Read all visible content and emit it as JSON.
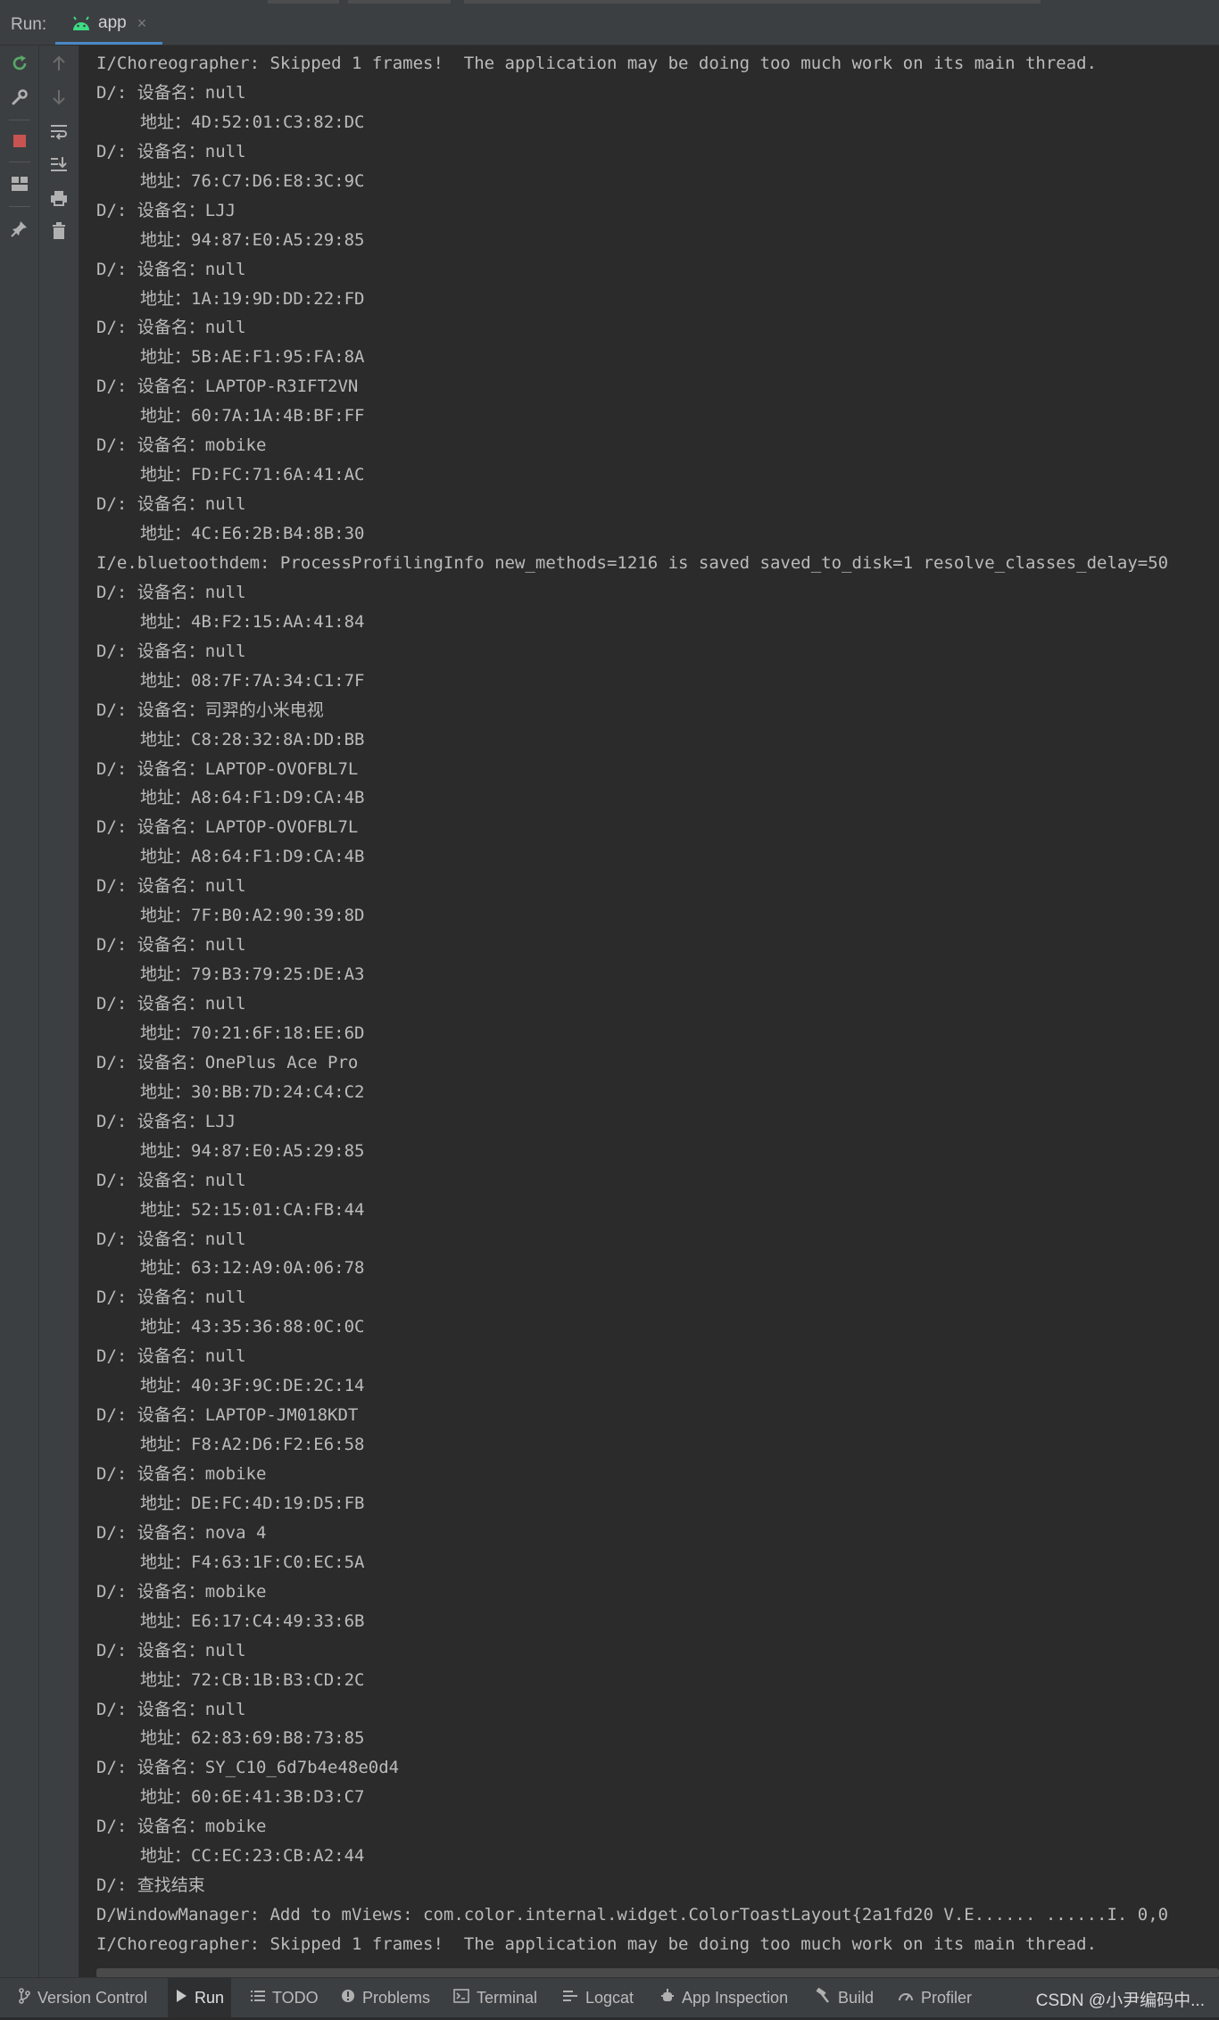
{
  "run_panel": {
    "label": "Run:",
    "tab": {
      "label": "app",
      "close": "×"
    }
  },
  "toolbar_left": {
    "icons": [
      "rerun-icon",
      "wrench-icon",
      "stop-icon",
      "layout-icon",
      "pin-icon"
    ]
  },
  "toolbar_right": {
    "icons": [
      "arrow-up-icon",
      "arrow-down-icon",
      "soft-wrap-icon",
      "scroll-to-end-icon",
      "print-icon",
      "trash-icon"
    ]
  },
  "colors": {
    "background": "#2b2b2b",
    "panel": "#3c3f41",
    "text": "#bbbbbb",
    "rerun": "#59a869",
    "stop": "#c75450",
    "android": "#3ddc84",
    "accent": "#4a88c7"
  },
  "console": {
    "lines": [
      "I/Choreographer: Skipped 1 frames!  The application may be doing too much work on its main thread.",
      "D/: 设备名：null",
      "地址：4D:52:01:C3:82:DC",
      "D/: 设备名：null",
      "地址：76:C7:D6:E8:3C:9C",
      "D/: 设备名：LJJ",
      "地址：94:87:E0:A5:29:85",
      "D/: 设备名：null",
      "地址：1A:19:9D:DD:22:FD",
      "D/: 设备名：null",
      "地址：5B:AE:F1:95:FA:8A",
      "D/: 设备名：LAPTOP-R3IFT2VN",
      "地址：60:7A:1A:4B:BF:FF",
      "D/: 设备名：mobike",
      "地址：FD:FC:71:6A:41:AC",
      "D/: 设备名：null",
      "地址：4C:E6:2B:B4:8B:30",
      "I/e.bluetoothdem: ProcessProfilingInfo new_methods=1216 is saved saved_to_disk=1 resolve_classes_delay=50",
      "D/: 设备名：null",
      "地址：4B:F2:15:AA:41:84",
      "D/: 设备名：null",
      "地址：08:7F:7A:34:C1:7F",
      "D/: 设备名：司羿的小米电视",
      "地址：C8:28:32:8A:DD:BB",
      "D/: 设备名：LAPTOP-OVOFBL7L",
      "地址：A8:64:F1:D9:CA:4B",
      "D/: 设备名：LAPTOP-OVOFBL7L",
      "地址：A8:64:F1:D9:CA:4B",
      "D/: 设备名：null",
      "地址：7F:B0:A2:90:39:8D",
      "D/: 设备名：null",
      "地址：79:B3:79:25:DE:A3",
      "D/: 设备名：null",
      "地址：70:21:6F:18:EE:6D",
      "D/: 设备名：OnePlus Ace Pro",
      "地址：30:BB:7D:24:C4:C2",
      "D/: 设备名：LJJ",
      "地址：94:87:E0:A5:29:85",
      "D/: 设备名：null",
      "地址：52:15:01:CA:FB:44",
      "D/: 设备名：null",
      "地址：63:12:A9:0A:06:78",
      "D/: 设备名：null",
      "地址：43:35:36:88:0C:0C",
      "D/: 设备名：null",
      "地址：40:3F:9C:DE:2C:14",
      "D/: 设备名：LAPTOP-JM018KDT",
      "地址：F8:A2:D6:F2:E6:58",
      "D/: 设备名：mobike",
      "地址：DE:FC:4D:19:D5:FB",
      "D/: 设备名：nova 4",
      "地址：F4:63:1F:C0:EC:5A",
      "D/: 设备名：mobike",
      "地址：E6:17:C4:49:33:6B",
      "D/: 设备名：null",
      "地址：72:CB:1B:B3:CD:2C",
      "D/: 设备名：null",
      "地址：62:83:69:B8:73:85",
      "D/: 设备名：SY_C10_6d7b4e48e0d4",
      "地址：60:6E:41:3B:D3:C7",
      "D/: 设备名：mobike",
      "地址：CC:EC:23:CB:A2:44",
      "D/: 查找结束",
      "D/WindowManager: Add to mViews: com.color.internal.widget.ColorToastLayout{2a1fd20 V.E...... ......I. 0,0",
      "I/Choreographer: Skipped 1 frames!  The application may be doing too much work on its main thread."
    ]
  },
  "bottom_bar": {
    "items": [
      {
        "label": "Version Control",
        "icon": "branch-icon"
      },
      {
        "label": "Run",
        "icon": "play-icon"
      },
      {
        "label": "TODO",
        "icon": "list-icon"
      },
      {
        "label": "Problems",
        "icon": "info-icon"
      },
      {
        "label": "Terminal",
        "icon": "terminal-icon"
      },
      {
        "label": "Logcat",
        "icon": "logcat-icon"
      },
      {
        "label": "App Inspection",
        "icon": "inspect-icon"
      },
      {
        "label": "Build",
        "icon": "hammer-icon"
      },
      {
        "label": "Profiler",
        "icon": "gauge-icon"
      }
    ],
    "watermark": "CSDN @小尹编码中..."
  }
}
